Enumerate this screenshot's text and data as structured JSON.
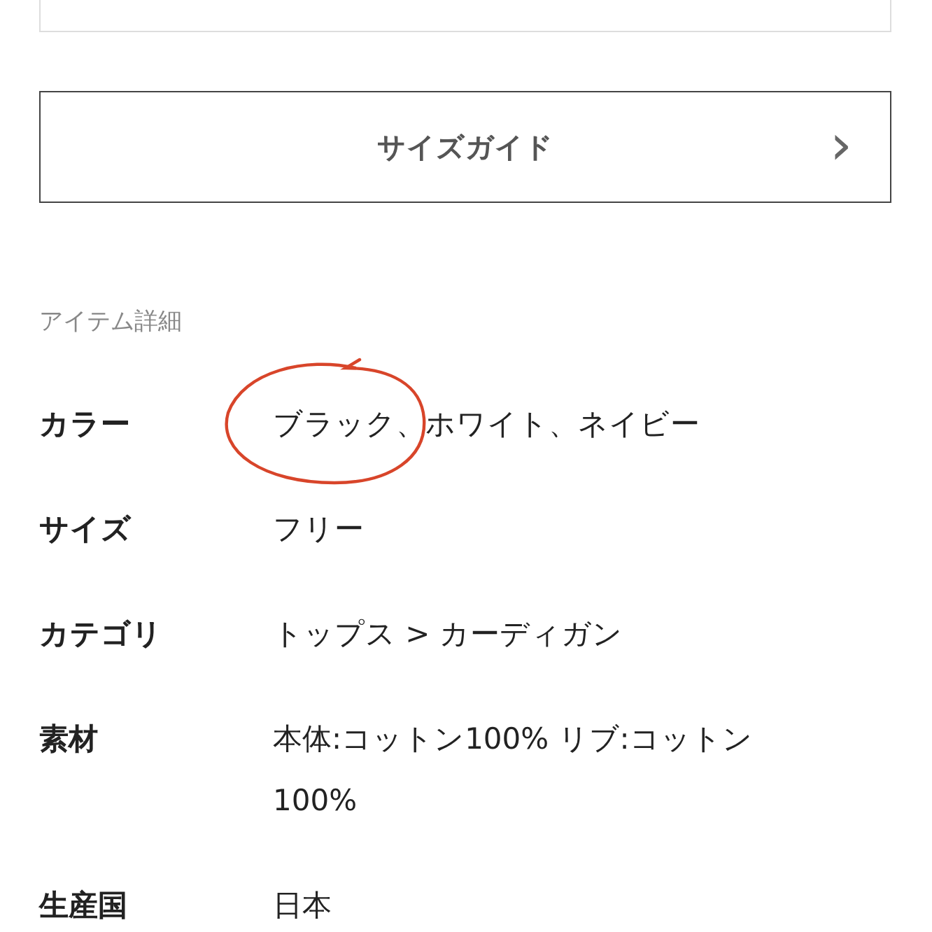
{
  "size_guide": {
    "label": "サイズガイド",
    "chevron": "›"
  },
  "details": {
    "title": "アイテム詳細",
    "rows": [
      {
        "label": "カラー",
        "annotation": {
          "kind": "hand-drawn-circle",
          "text": "ブラック、"
        },
        "value": "ホワイト、ネイビー"
      },
      {
        "label": "サイズ",
        "value": "フリー"
      },
      {
        "label": "カテゴリ",
        "value": "トップス > カーディガン"
      },
      {
        "label": "素材",
        "value": "本体:コットン100% リブ:コットン100%"
      },
      {
        "label": "生産国",
        "value": "日本"
      }
    ]
  }
}
